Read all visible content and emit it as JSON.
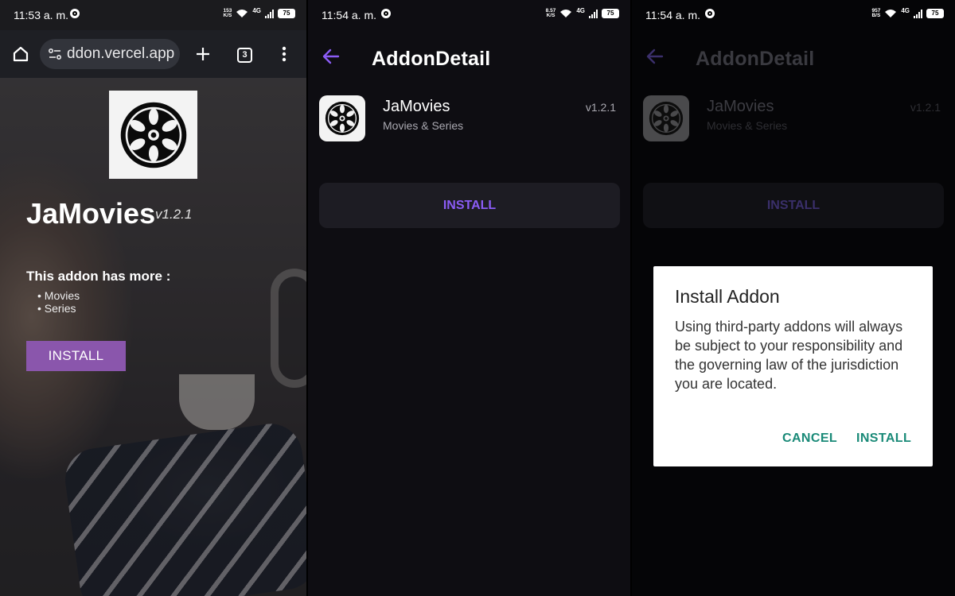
{
  "panel1": {
    "status": {
      "time": "11:53 a. m.",
      "speed_value": "153",
      "speed_unit": "K/S",
      "network": "4G",
      "battery": "75"
    },
    "browser": {
      "url": "ddon.vercel.app",
      "tab_count": "3"
    },
    "page": {
      "addon_name": "JaMovies",
      "version": "v1.2.1",
      "more_heading": "This addon has more :",
      "features": [
        "Movies",
        "Series"
      ],
      "install_label": "INSTALL"
    }
  },
  "panel2": {
    "status": {
      "time": "11:54 a. m.",
      "speed_value": "8.57",
      "speed_unit": "K/S",
      "network": "4G",
      "battery": "75"
    },
    "header": {
      "title": "AddonDetail"
    },
    "addon": {
      "name": "JaMovies",
      "category": "Movies & Series",
      "version": "v1.2.1"
    },
    "install_label": "INSTALL"
  },
  "panel3": {
    "status": {
      "time": "11:54 a. m.",
      "speed_value": "957",
      "speed_unit": "B/S",
      "network": "4G",
      "battery": "75"
    },
    "header": {
      "title": "AddonDetail"
    },
    "addon": {
      "name": "JaMovies",
      "category": "Movies & Series",
      "version": "v1.2.1"
    },
    "install_label": "INSTALL",
    "dialog": {
      "title": "Install Addon",
      "body": "Using third-party addons will always be subject to your responsibility and the governing law of the jurisdiction you are located.",
      "cancel_label": "CANCEL",
      "confirm_label": "INSTALL"
    }
  },
  "colors": {
    "accent_purple": "#8b5cf6",
    "web_button": "#8a56ac",
    "dialog_teal": "#1a8a78"
  },
  "icons": [
    "home-icon",
    "site-settings-icon",
    "plus-icon",
    "tab-switcher-icon",
    "more-vert-icon",
    "back-arrow-icon",
    "film-reel-icon",
    "wifi-icon",
    "signal-icon",
    "battery-icon"
  ]
}
